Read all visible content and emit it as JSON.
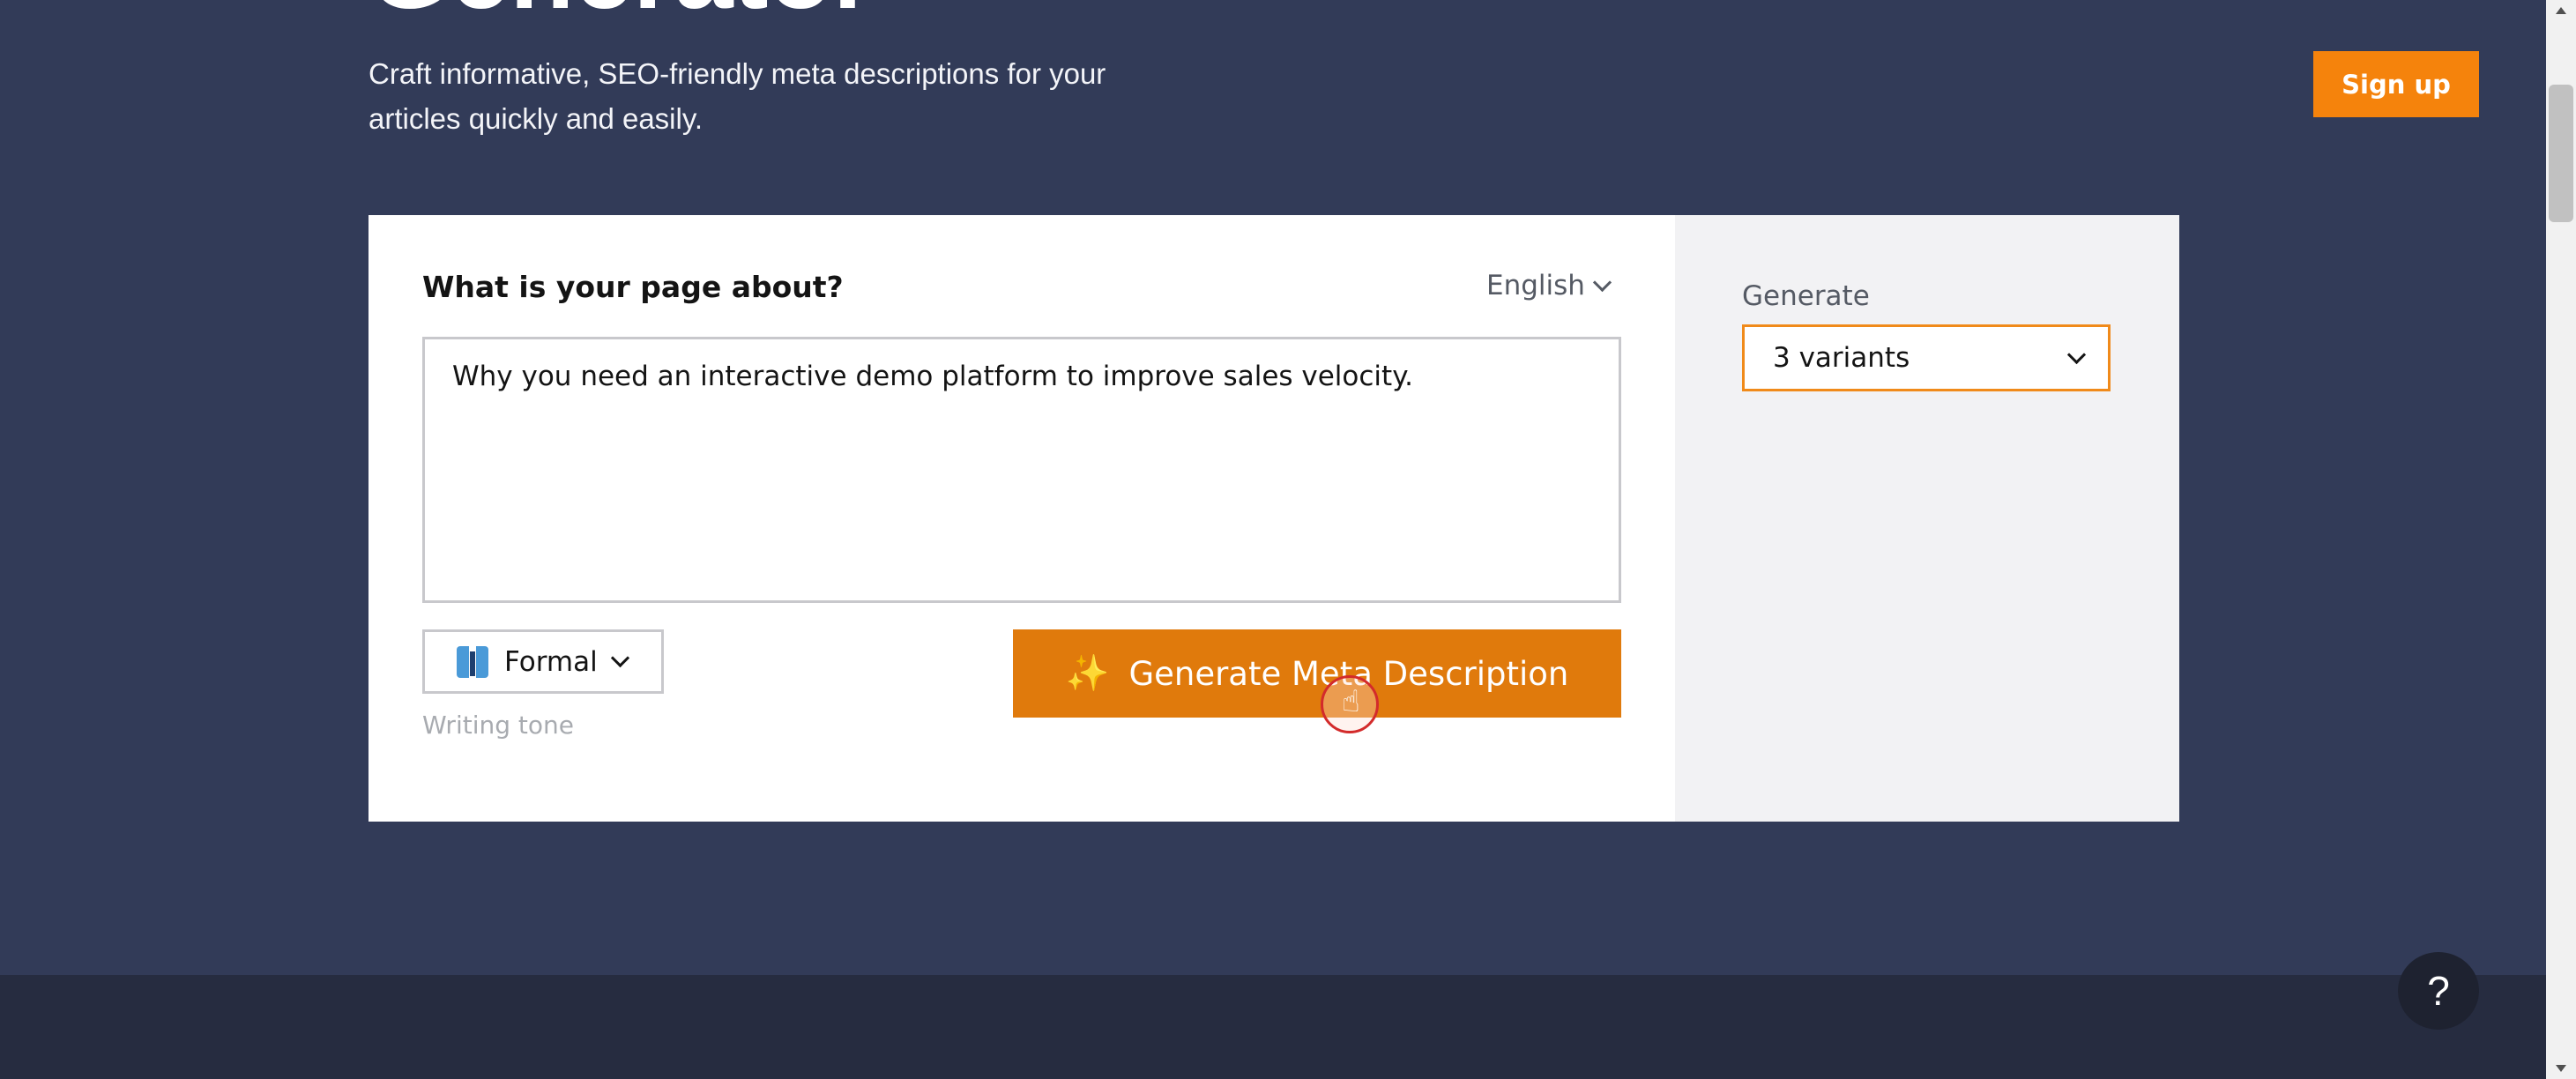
{
  "hero": {
    "title": "Generator",
    "subtitle": "Craft informative, SEO-friendly meta descriptions for your articles quickly and easily."
  },
  "header": {
    "signup_label": "Sign up"
  },
  "form": {
    "question_label": "What is your page about?",
    "language": "English",
    "topic_value": "Why you need an interactive demo platform to improve sales velocity.",
    "tone": {
      "value": "Formal",
      "icon": "necktie-icon",
      "caption": "Writing tone"
    },
    "generate_button": {
      "label": "Generate Meta Description",
      "icon": "sparkle-icon"
    }
  },
  "sidebar": {
    "generate_label": "Generate",
    "variants_value": "3 variants"
  },
  "help": {
    "label": "?"
  },
  "colors": {
    "background": "#323b58",
    "accent": "#f5830c",
    "button": "#e07a0c",
    "card": "#ffffff",
    "card_side": "#f2f2f4"
  }
}
